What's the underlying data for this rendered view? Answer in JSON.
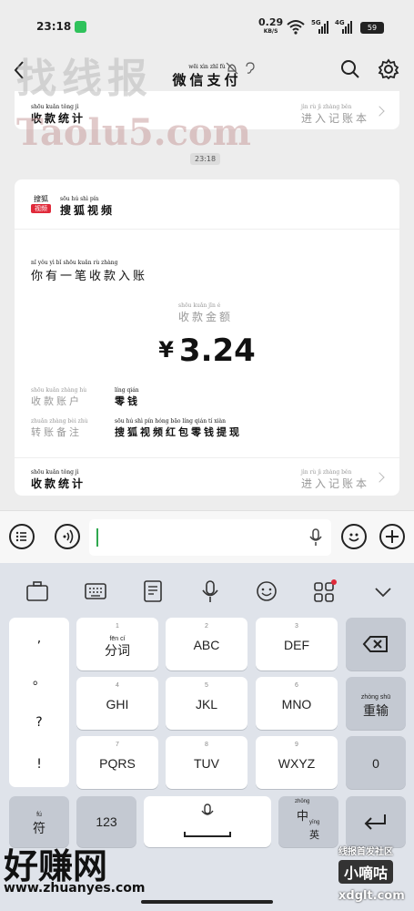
{
  "status": {
    "time": "23:18",
    "speed": "0.29",
    "speed_unit": "KB/S",
    "sim1": "5G",
    "sim2": "4G",
    "battery": "59"
  },
  "nav": {
    "title": "微信支付",
    "title_pinyin": "wēi xìn zhī fù"
  },
  "top_card": {
    "label": "收款统计",
    "label_pinyin": "shōu kuǎn tǒng jì",
    "link": "进入记账本",
    "link_pinyin": "jìn rù jì zhàng běn"
  },
  "timestamp": "23:18",
  "card": {
    "brand_logo_top": "搜狐",
    "brand_logo_tag": "视频",
    "brand_name": "搜狐视频",
    "brand_pinyin": "sōu hú shì pín",
    "headline": "你有一笔收款入账",
    "headline_pinyin": "nǐ yǒu yì bǐ shōu kuǎn rù zhàng",
    "amount_label": "收款金额",
    "amount_label_pinyin": "shōu kuǎn jīn é",
    "currency": "¥",
    "amount": "3.24",
    "rows": [
      {
        "key": "收款账户",
        "key_pinyin": "shōu kuǎn zhàng hù",
        "value": "零钱",
        "value_pinyin": "líng qián"
      },
      {
        "key": "转账备注",
        "key_pinyin": "zhuǎn zhàng bèi zhù",
        "value": "搜狐视频红包零钱提现",
        "value_pinyin": "sōu hú shì pín hóng bāo líng qián tí xiàn"
      }
    ],
    "footer_label": "收款统计",
    "footer_pinyin": "shōu kuǎn tǒng jì",
    "footer_link": "进入记账本",
    "footer_link_pinyin": "jìn rù jì zhàng běn"
  },
  "watermarks": {
    "top": "找线报",
    "mid": "Taolu5.com",
    "bottom_big": "好赚网",
    "bottom_url": "www.zhuanyes.com",
    "br1": "线报首发社区",
    "br2": "小嘀咕",
    "br3": "xdglt.com"
  },
  "keyboard": {
    "punct": [
      ",",
      "。",
      "?",
      "!"
    ],
    "keys": [
      {
        "num": "1",
        "label": "分词",
        "pinyin": "fēn cí"
      },
      {
        "num": "2",
        "label": "ABC"
      },
      {
        "num": "3",
        "label": "DEF"
      },
      {
        "num": "4",
        "label": "GHI"
      },
      {
        "num": "5",
        "label": "JKL"
      },
      {
        "num": "6",
        "label": "MNO"
      },
      {
        "num": "7",
        "label": "PQRS"
      },
      {
        "num": "8",
        "label": "TUV"
      },
      {
        "num": "9",
        "label": "WXYZ"
      }
    ],
    "reinput": "重输",
    "reinput_pinyin": "zhòng shū",
    "zero": "0",
    "symbol": "符",
    "symbol_pinyin": "fú",
    "num_switch": "123",
    "lang_top": "中",
    "lang_top_pinyin": "zhōng",
    "lang_bottom": "英",
    "lang_bottom_pinyin": "yīng"
  },
  "colors": {
    "accent_green": "#2fa84f",
    "brand_red": "#e02a3a"
  }
}
